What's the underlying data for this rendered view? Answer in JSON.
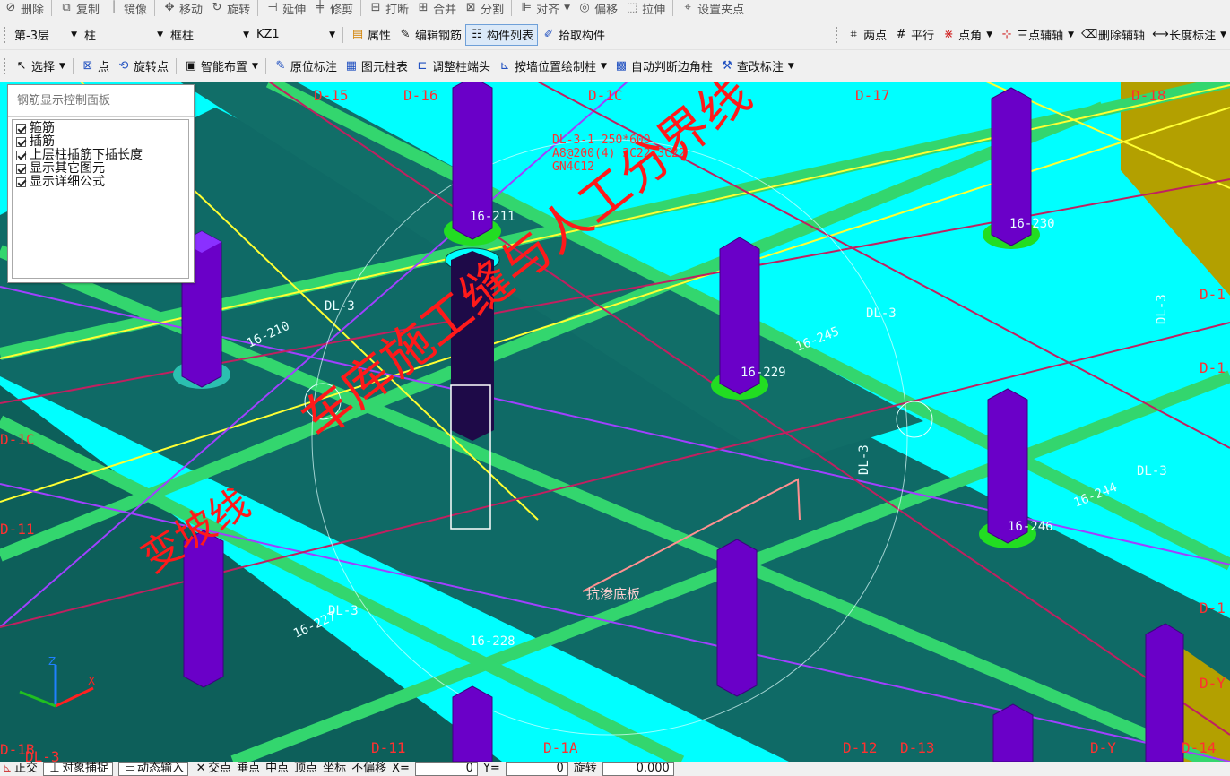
{
  "toolbar_top": {
    "items": [
      "删除",
      "复制",
      "镜像",
      "移动",
      "旋转",
      "延伸",
      "修剪",
      "打断",
      "合并",
      "分割",
      "对齐",
      "偏移",
      "拉伸",
      "设置夹点"
    ]
  },
  "toolbar_main": {
    "floor": "第-3层",
    "category": "柱",
    "subtype": "框柱",
    "element": "KZ1",
    "props": "属性",
    "edit_rebar": "编辑钢筋",
    "component_list": "构件列表",
    "pick_component": "拾取构件",
    "two_point": "两点",
    "parallel": "平行",
    "point_angle": "点角",
    "three_point_axis": "三点辅轴",
    "delete_axis": "删除辅轴",
    "length_label": "长度标注"
  },
  "toolbar_draw": {
    "select": "选择",
    "point": "点",
    "rotate_point": "旋转点",
    "smart_layout": "智能布置",
    "in_situ_label": "原位标注",
    "element_column_table": "图元柱表",
    "adjust_column_end": "调整柱端头",
    "draw_by_wall": "按墙位置绘制柱",
    "auto_corner_column": "自动判断边角柱",
    "check_label": "查改标注"
  },
  "rebar_panel": {
    "title": "钢筋显示控制面板",
    "options": [
      {
        "label": "箍筋",
        "checked": true
      },
      {
        "label": "插筋",
        "checked": true
      },
      {
        "label": "上层柱插筋下插长度",
        "checked": true
      },
      {
        "label": "显示其它图元",
        "checked": true
      },
      {
        "label": "显示详细公式",
        "checked": true
      }
    ]
  },
  "canvas": {
    "axis_labels": [
      "D-15",
      "D-16",
      "D-1C",
      "D-17",
      "D-18",
      "D-1C",
      "D-11",
      "D-1B",
      "D-11",
      "D-1A",
      "D-12",
      "D-13",
      "D-Y",
      "D-14",
      "D-1",
      "D-1",
      "D-1",
      "D-Y",
      "DL-3"
    ],
    "beam_annotation": [
      "DL-3-1  250*600",
      "A8@200(4) 3C22;3C22",
      "GN4C12"
    ],
    "column_tags": [
      "16-211",
      "16-230",
      "16-210",
      "16-229",
      "16-246",
      "16-228",
      "16-227",
      "16-245",
      "16-244"
    ],
    "beam_tags": [
      "DL-3",
      "DL-3",
      "DL-3",
      "DL-3",
      "DL-3",
      "DL-3"
    ],
    "red_text_main": "车库施工缝与人工分界线",
    "red_text_slope": "变坡线",
    "slab_label": "抗渗底板"
  },
  "status_bar": {
    "items": [
      "正交",
      "对象捕捉",
      "动态输入",
      "交点",
      "垂点",
      "中点",
      "顶点",
      "坐标",
      "不偏移",
      "X=",
      "0",
      "Y=",
      "0",
      "旋转",
      "0.000"
    ]
  },
  "colors": {
    "cyan": "#00ffff",
    "slab_dark": "#0f6a66",
    "beam_green": "#33d66e",
    "column_purple": "#6a00c8",
    "red_text": "#ff1a1a",
    "yellow_line": "#ffff33",
    "olive_wall": "#b3a000"
  }
}
